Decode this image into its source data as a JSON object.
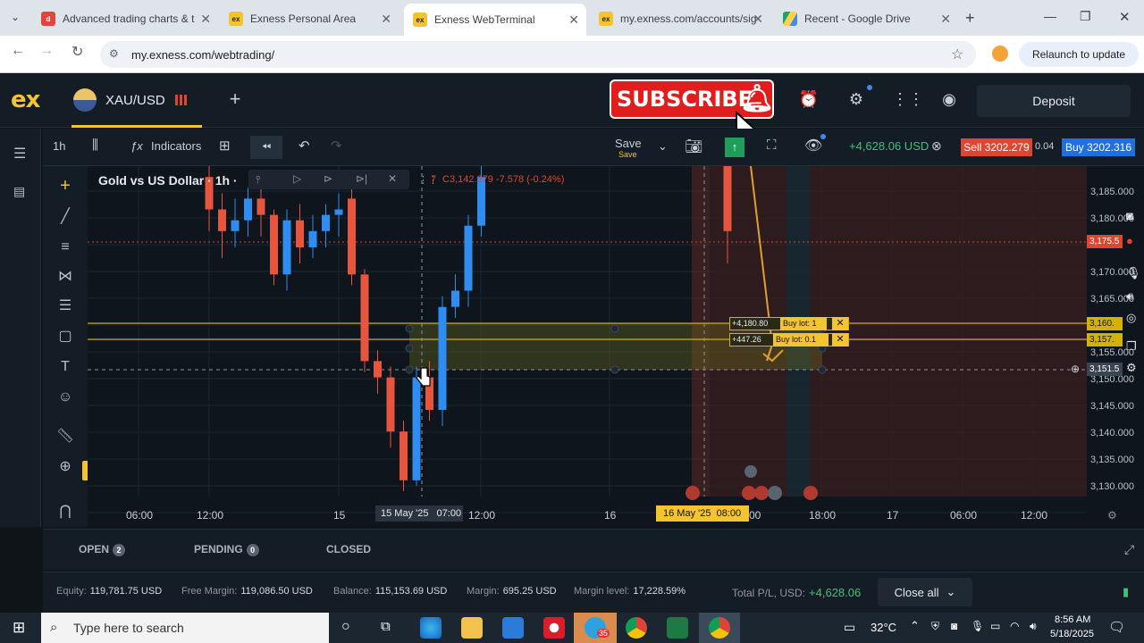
{
  "browser": {
    "tabs": [
      {
        "title": "Advanced trading charts & t",
        "icon": "tradingview-icon",
        "active": false
      },
      {
        "title": "Exness Personal Area",
        "icon": "exness-icon",
        "active": false
      },
      {
        "title": "Exness WebTerminal",
        "icon": "exness-icon",
        "active": true
      },
      {
        "title": "my.exness.com/accounts/sig",
        "icon": "exness-icon",
        "active": false
      },
      {
        "title": "Recent - Google Drive",
        "icon": "google-drive-icon",
        "active": false
      }
    ],
    "url": "my.exness.com/webtrading/",
    "relaunch_label": "Relaunch to update"
  },
  "header": {
    "logo": "ex",
    "symbol": "XAU/USD",
    "deposit_label": "Deposit",
    "subscribe_label": "SUBSCRIBE"
  },
  "toolbar": {
    "timeframe": "1h",
    "indicators_label": "Indicators",
    "save_label": "Save",
    "save_sub": "Save",
    "pnl": "+4,628.06 USD",
    "sell_label": "Sell 3202.279",
    "spread": "0.04",
    "buy_label": "Buy 3202.316"
  },
  "chart": {
    "title": "Gold vs US Dollar · 1h ·",
    "ohlc": "C3,142.379  -7.578 (-0.24%)",
    "ohlc_prefix": "7",
    "price_ticks": [
      "3,185.000",
      "3,180.000",
      "3,170.000",
      "3,165.000",
      "3,155.000",
      "3,150.000",
      "3,145.000",
      "3,140.000",
      "3,135.000",
      "3,130.000"
    ],
    "price_tags": [
      {
        "label": "3,175.5",
        "color": "#e0462f"
      },
      {
        "label": "3,160.",
        "color": "#d4b106"
      },
      {
        "label": "3,157.",
        "color": "#d4b106"
      },
      {
        "label": "3,151.5",
        "color": "#3a4552"
      }
    ],
    "time_ticks": [
      "06:00",
      "12:00",
      "15",
      "12:00",
      "16",
      "18:00",
      "17",
      "06:00",
      "12:00"
    ],
    "crosshair_left": "15 May '25",
    "crosshair_left_time": "07:00",
    "crosshair_right": "16 May '25  08:00",
    "crosshair_right_tail": "00",
    "orders": [
      {
        "pnl": "+4,180.80",
        "lot": "Buy lot: 1"
      },
      {
        "pnl": "+447.26",
        "lot": "Buy lot: 0.1"
      }
    ]
  },
  "chart_data": {
    "type": "candlestick",
    "title": "Gold vs US Dollar · 1h",
    "ylim": [
      3127,
      3188
    ],
    "candles": [
      {
        "o": 3186,
        "c": 3180,
        "h": 3188,
        "l": 3176
      },
      {
        "o": 3180,
        "c": 3176,
        "h": 3183,
        "l": 3171
      },
      {
        "o": 3176,
        "c": 3178,
        "h": 3182,
        "l": 3173
      },
      {
        "o": 3178,
        "c": 3182,
        "h": 3184,
        "l": 3175
      },
      {
        "o": 3182,
        "c": 3179,
        "h": 3186,
        "l": 3175
      },
      {
        "o": 3179,
        "c": 3168,
        "h": 3180,
        "l": 3166
      },
      {
        "o": 3168,
        "c": 3178,
        "h": 3180,
        "l": 3165
      },
      {
        "o": 3178,
        "c": 3173,
        "h": 3181,
        "l": 3170
      },
      {
        "o": 3173,
        "c": 3176,
        "h": 3179,
        "l": 3171
      },
      {
        "o": 3176,
        "c": 3179,
        "h": 3181,
        "l": 3173
      },
      {
        "o": 3179,
        "c": 3180,
        "h": 3183,
        "l": 3175
      },
      {
        "o": 3182,
        "c": 3168,
        "h": 3184,
        "l": 3166
      },
      {
        "o": 3168,
        "c": 3152,
        "h": 3169,
        "l": 3150
      },
      {
        "o": 3152,
        "c": 3149,
        "h": 3154,
        "l": 3146
      },
      {
        "o": 3149,
        "c": 3139,
        "h": 3151,
        "l": 3136
      },
      {
        "o": 3139,
        "c": 3130,
        "h": 3141,
        "l": 3128
      },
      {
        "o": 3130,
        "c": 3149,
        "h": 3151,
        "l": 3129
      },
      {
        "o": 3149,
        "c": 3143,
        "h": 3152,
        "l": 3141
      },
      {
        "o": 3143,
        "c": 3162,
        "h": 3164,
        "l": 3140
      },
      {
        "o": 3162,
        "c": 3165,
        "h": 3168,
        "l": 3160
      },
      {
        "o": 3165,
        "c": 3177,
        "h": 3179,
        "l": 3162
      },
      {
        "o": 3177,
        "c": 3186,
        "h": 3189,
        "l": 3175
      }
    ],
    "right_candles": [
      {
        "o": 3190,
        "c": 3176,
        "h": 3192,
        "l": 3170
      }
    ]
  },
  "panels": {
    "open_label": "OPEN",
    "open_count": "2",
    "pending_label": "PENDING",
    "pending_count": "0",
    "closed_label": "CLOSED"
  },
  "account": {
    "equity_label": "Equity:",
    "equity": "119,781.75 USD",
    "free_margin_label": "Free Margin:",
    "free_margin": "119,086.50 USD",
    "balance_label": "Balance:",
    "balance": "115,153.69 USD",
    "margin_label": "Margin:",
    "margin": "695.25 USD",
    "margin_level_label": "Margin level:",
    "margin_level": "17,228.59%",
    "total_pl_label": "Total P/L, USD:",
    "total_pl": "+4,628.06",
    "close_all_label": "Close all"
  },
  "taskbar": {
    "search_placeholder": "Type here to search",
    "temperature": "32°C",
    "time": "8:56 AM",
    "date": "5/18/2025",
    "telegram_badge": "35"
  },
  "colors": {
    "accent": "#f4c430",
    "up": "#2f8cf0",
    "down": "#e8553f",
    "sell": "#e0462f",
    "buy": "#1e6fe0",
    "pnl": "#3fc17a"
  }
}
